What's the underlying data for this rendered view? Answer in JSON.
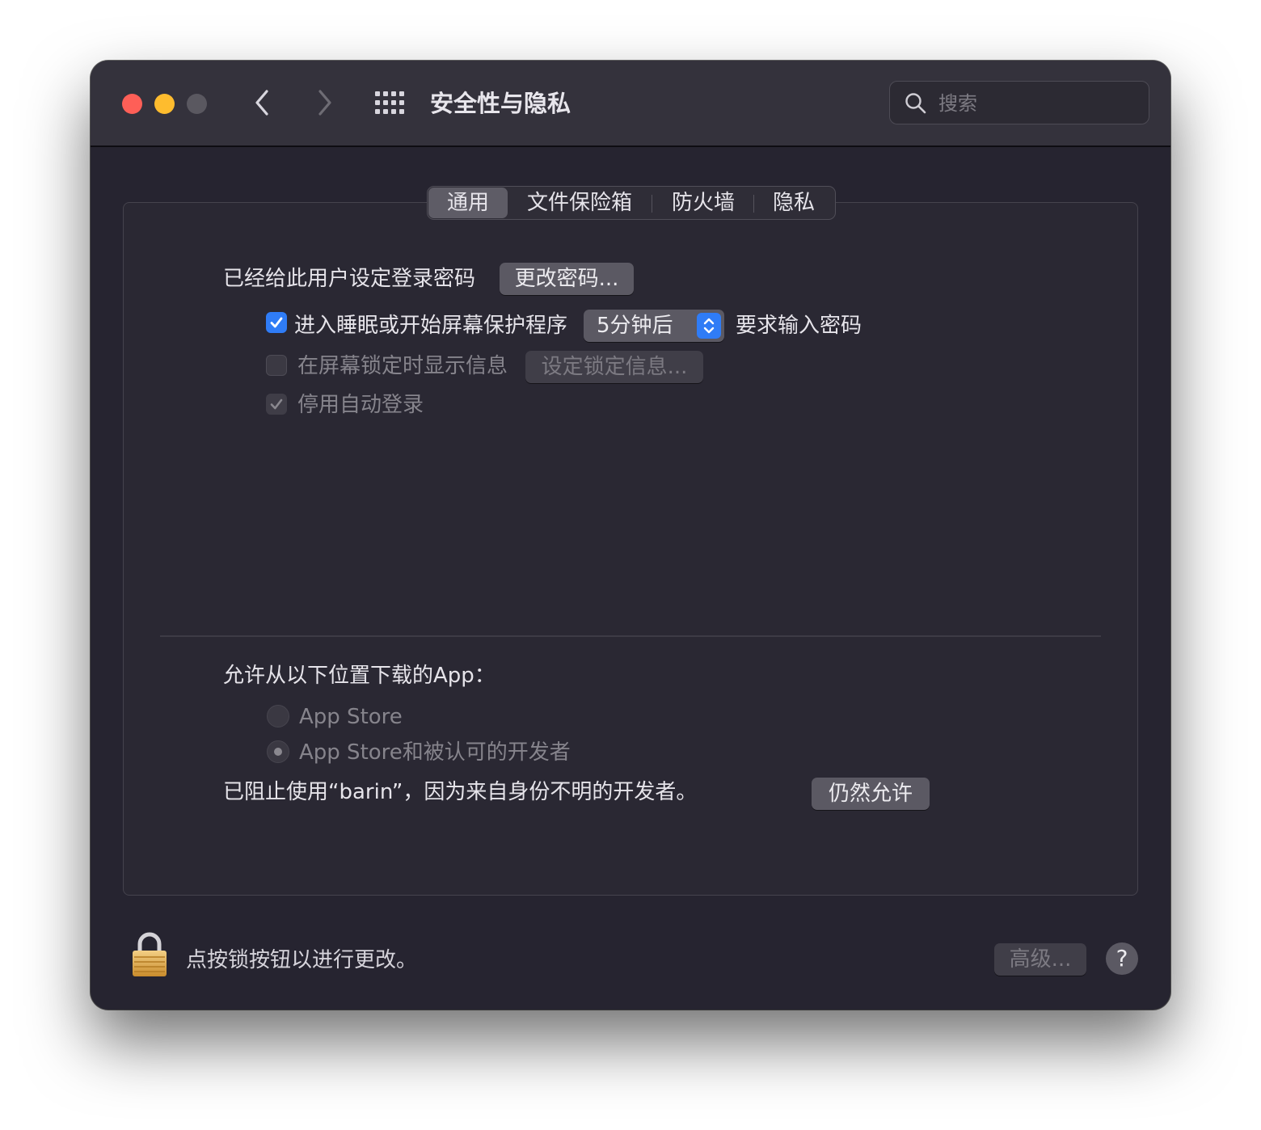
{
  "window": {
    "title": "安全性与隐私",
    "search_placeholder": "搜索"
  },
  "tabs": [
    {
      "label": "通用",
      "selected": true
    },
    {
      "label": "文件保险箱",
      "selected": false
    },
    {
      "label": "防火墙",
      "selected": false
    },
    {
      "label": "隐私",
      "selected": false
    }
  ],
  "general": {
    "password_set_label": "已经给此用户设定登录密码",
    "change_password_button": "更改密码...",
    "require_password": {
      "checked": true,
      "label_before": "进入睡眠或开始屏幕保护程序",
      "delay_value": "5分钟后",
      "label_after": "要求输入密码"
    },
    "show_message": {
      "checked": false,
      "enabled": false,
      "label": "在屏幕锁定时显示信息",
      "button": "设定锁定信息..."
    },
    "disable_auto_login": {
      "checked": true,
      "enabled": false,
      "label": "停用自动登录"
    }
  },
  "downloads": {
    "heading": "允许从以下位置下载的App：",
    "options": [
      {
        "label": "App Store",
        "selected": false
      },
      {
        "label": "App Store和被认可的开发者",
        "selected": true
      }
    ],
    "blocked_message": "已阻止使用“barin”，因为来自身份不明的开发者。",
    "allow_anyway_button": "仍然允许"
  },
  "footer": {
    "lock_message": "点按锁按钮以进行更改。",
    "advanced_button": "高级...",
    "help_button": "?"
  },
  "colors": {
    "accent": "#2f7cf6",
    "window_bg": "#262430",
    "titlebar_bg": "#34323c",
    "close": "#fe5f57",
    "minimize": "#febc2e"
  }
}
